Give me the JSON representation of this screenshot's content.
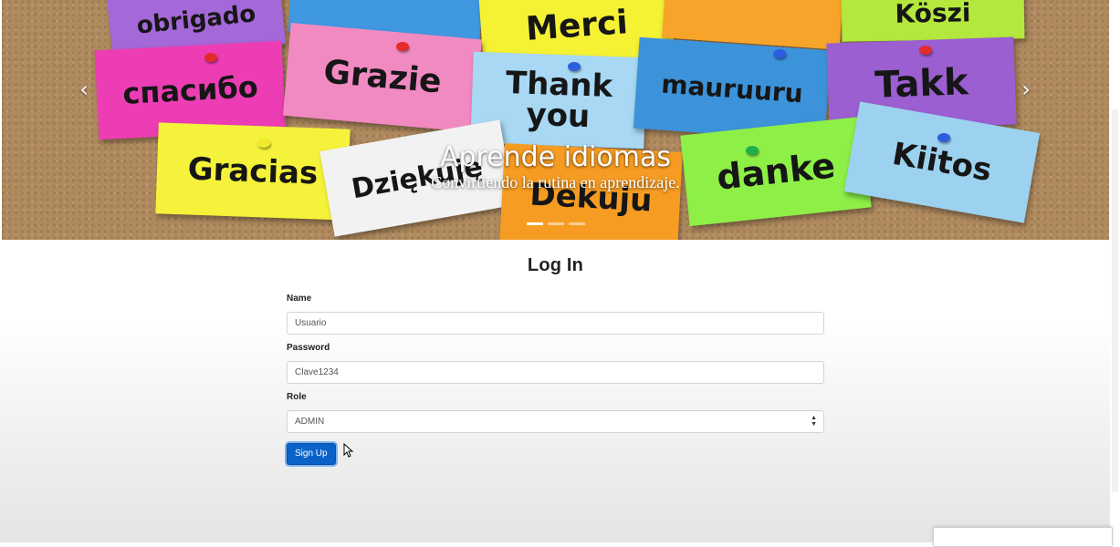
{
  "carousel": {
    "caption_title": "Aprende idiomas",
    "caption_subtitle": "Convirtiendo la rutina en aprendizaje.",
    "slide_count": 3,
    "active_slide": 1,
    "prev_icon": "chevron-left-icon",
    "next_icon": "chevron-right-icon",
    "notes": [
      "obrigado",
      "Merci",
      "Köszi",
      "спасибо",
      "Grazie",
      "Thank you",
      "mauruuru",
      "Takk",
      "Gracias",
      "Dziękuję",
      "Dekuju",
      "danke",
      "Kiitos"
    ]
  },
  "form": {
    "title": "Log In",
    "name_label": "Name",
    "name_value": "Usuario",
    "password_label": "Password",
    "password_value": "Clave1234",
    "role_label": "Role",
    "role_value": "ADMIN",
    "submit_label": "Sign Up"
  },
  "colors": {
    "primary_button": "#0a62c9",
    "cork_board": "#b08a5e"
  }
}
